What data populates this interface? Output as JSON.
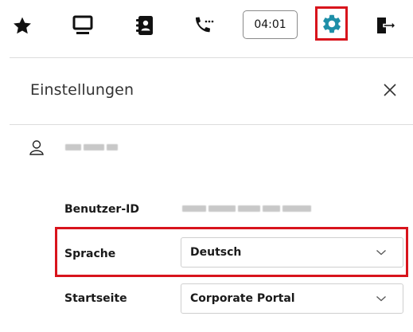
{
  "toolbar": {
    "items": [
      {
        "name": "favorites",
        "icon": "star-icon"
      },
      {
        "name": "desktop",
        "icon": "monitor-icon"
      },
      {
        "name": "contacts",
        "icon": "address-book-icon"
      },
      {
        "name": "calls",
        "icon": "phone-icon"
      },
      {
        "name": "settings",
        "icon": "gear-icon",
        "active": true
      },
      {
        "name": "logout",
        "icon": "exit-icon"
      }
    ],
    "timer": "04:01"
  },
  "colors": {
    "accent": "#1e8fa8",
    "highlight": "#d8141c"
  },
  "panel": {
    "title": "Einstellungen",
    "close_icon": "close-icon",
    "user_icon": "user-icon"
  },
  "fields": {
    "user_id_label": "Benutzer-ID",
    "language_label": "Sprache",
    "language_value": "Deutsch",
    "startpage_label": "Startseite",
    "startpage_value": "Corporate Portal"
  }
}
